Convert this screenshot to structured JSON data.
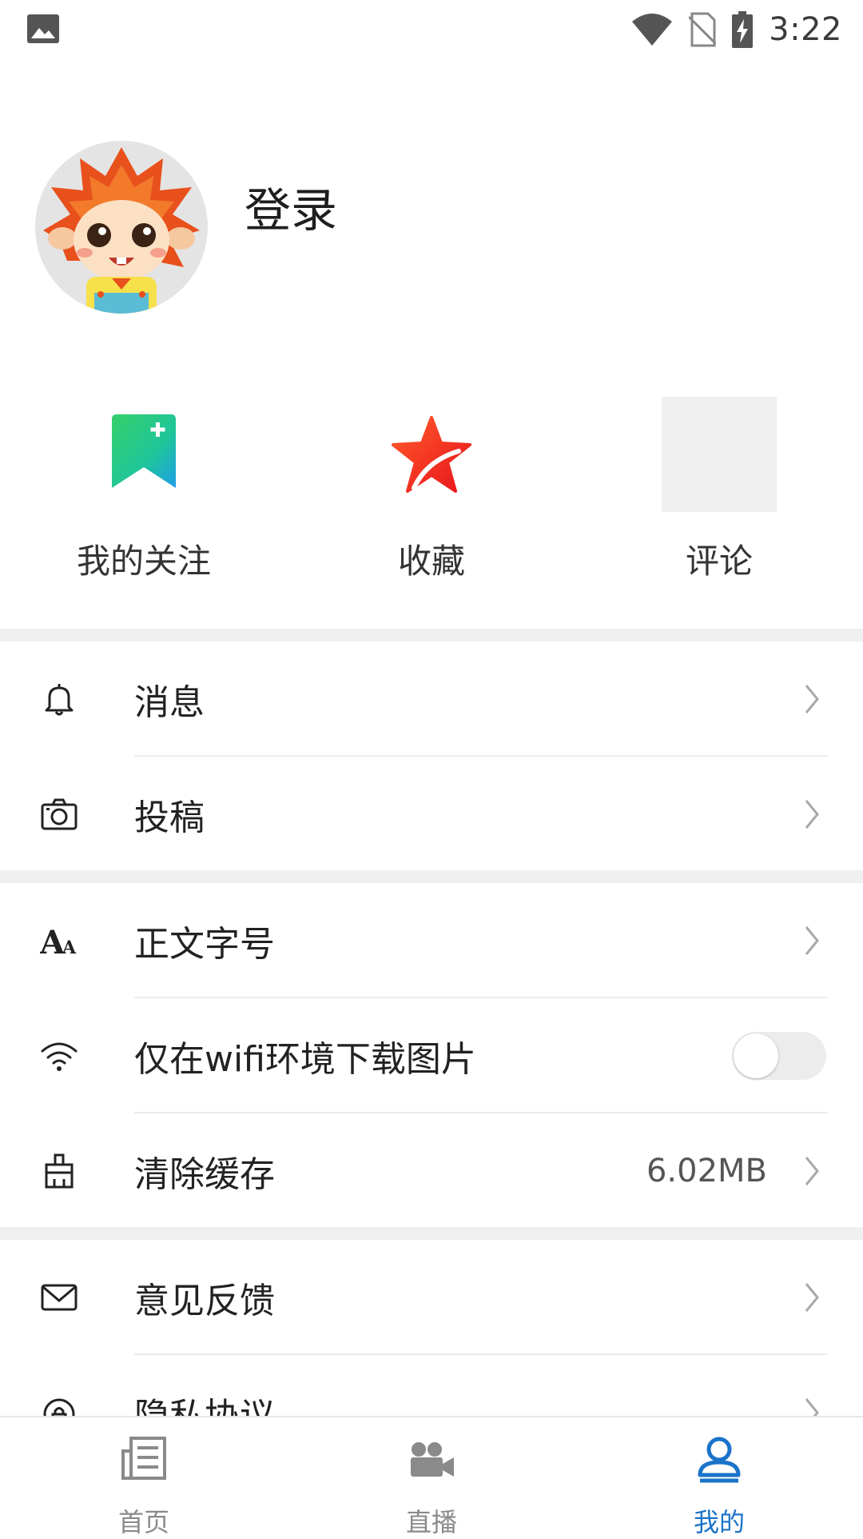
{
  "status_bar": {
    "time": "3:22",
    "icons": [
      "gallery-icon",
      "wifi-signal-icon",
      "no-sim-icon",
      "battery-charging-icon"
    ]
  },
  "profile": {
    "login_label": "登录",
    "avatar": "lion-mascot-avatar"
  },
  "shortcuts": [
    {
      "label": "我的关注",
      "icon": "bookmark-plus-icon"
    },
    {
      "label": "收藏",
      "icon": "star-icon"
    },
    {
      "label": "评论",
      "icon": "comment-placeholder-icon"
    }
  ],
  "menu": {
    "messages": {
      "label": "消息",
      "icon": "bell-icon"
    },
    "submit": {
      "label": "投稿",
      "icon": "camera-icon"
    },
    "font_size": {
      "label": "正文字号",
      "icon": "font-size-icon"
    },
    "wifi_only": {
      "label": "仅在wifi环境下载图片",
      "icon": "wifi-icon",
      "enabled": false
    },
    "clear_cache": {
      "label": "清除缓存",
      "icon": "broom-icon",
      "value": "6.02MB"
    },
    "feedback": {
      "label": "意见反馈",
      "icon": "mail-icon"
    },
    "privacy": {
      "label": "隐私协议",
      "icon": "privacy-icon"
    }
  },
  "bottom_nav": {
    "items": [
      {
        "label": "首页",
        "icon": "newspaper-icon",
        "active": false
      },
      {
        "label": "直播",
        "icon": "video-camera-icon",
        "active": false
      },
      {
        "label": "我的",
        "icon": "profile-icon",
        "active": true
      }
    ],
    "active_color": "#1a73c9",
    "inactive_color": "#8a8a8a"
  }
}
